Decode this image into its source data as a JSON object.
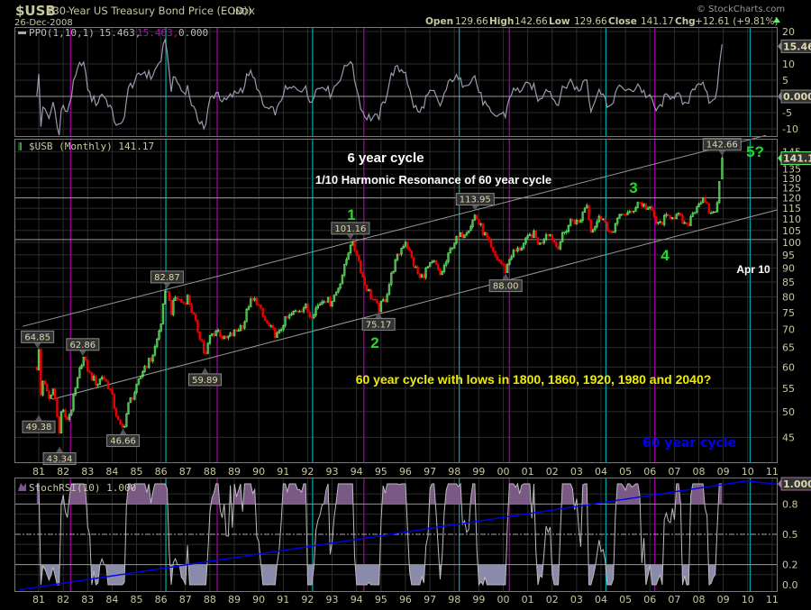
{
  "header": {
    "symbol": "$USB",
    "name": "(30-Year US Treasury Bond Price (EOD))",
    "exchange": "INDX",
    "date": "26-Dec-2008",
    "copyright": "© StockCharts.com",
    "open_label": "Open",
    "open": "129.66",
    "high_label": "High",
    "high": "142.66",
    "low_label": "Low",
    "low": "129.66",
    "close_label": "Close",
    "close": "141.17",
    "chg_label": "Chg",
    "chg": "+12.61 (+9.81%)"
  },
  "colors": {
    "up": "#66ee66",
    "down": "#ee0000",
    "cyan": "#00a0a0",
    "magenta": "#a000a0",
    "axis": "#c8c8a0",
    "blue": "#0000ee",
    "overbought": "#7a5a85",
    "oversold": "#8a8aaa"
  },
  "chart_data": {
    "type": "candlestick",
    "title": "$USB (30-Year US Treasury Bond Price (EOD)) Monthly",
    "x_tick_labels": [
      "81",
      "82",
      "83",
      "84",
      "85",
      "86",
      "87",
      "88",
      "89",
      "90",
      "91",
      "92",
      "93",
      "94",
      "95",
      "96",
      "97",
      "98",
      "99",
      "00",
      "01",
      "02",
      "03",
      "04",
      "05",
      "06",
      "07",
      "08",
      "09",
      "10",
      "11"
    ],
    "x_range_years": [
      1980.0,
      2011.5
    ],
    "price": {
      "legend": "$USB (Monthly) 141.17",
      "scale": "log",
      "ylim": [
        41,
        150
      ],
      "ticks": [
        "45",
        "50",
        "55",
        "60",
        "65",
        "70",
        "75",
        "80",
        "85",
        "90",
        "95",
        "100",
        "105",
        "110",
        "115",
        "120",
        "125",
        "130",
        "135",
        "145"
      ],
      "last_value_label": "141.17",
      "anchors": [
        [
          1980.92,
          60
        ],
        [
          1981.0,
          64.85
        ],
        [
          1981.05,
          52
        ],
        [
          1981.2,
          58
        ],
        [
          1981.4,
          52
        ],
        [
          1981.6,
          55
        ],
        [
          1981.75,
          50
        ],
        [
          1981.85,
          45
        ],
        [
          1981.95,
          52
        ],
        [
          1982.1,
          48
        ],
        [
          1982.3,
          50
        ],
        [
          1982.6,
          57
        ],
        [
          1982.8,
          62.86
        ],
        [
          1983.1,
          58
        ],
        [
          1983.4,
          56
        ],
        [
          1983.6,
          58
        ],
        [
          1983.9,
          55
        ],
        [
          1984.3,
          47
        ],
        [
          1984.45,
          46.66
        ],
        [
          1984.7,
          52
        ],
        [
          1985.0,
          55
        ],
        [
          1985.3,
          60
        ],
        [
          1985.6,
          62
        ],
        [
          1985.8,
          66
        ],
        [
          1986.0,
          72
        ],
        [
          1986.15,
          80
        ],
        [
          1986.25,
          82.87
        ],
        [
          1986.4,
          75
        ],
        [
          1986.6,
          80
        ],
        [
          1986.9,
          78
        ],
        [
          1987.1,
          80
        ],
        [
          1987.4,
          72
        ],
        [
          1987.7,
          66
        ],
        [
          1987.8,
          62
        ],
        [
          1988.0,
          68
        ],
        [
          1988.3,
          70
        ],
        [
          1988.6,
          67
        ],
        [
          1989.0,
          69
        ],
        [
          1989.4,
          72
        ],
        [
          1989.6,
          78
        ],
        [
          1989.9,
          79
        ],
        [
          1990.2,
          73
        ],
        [
          1990.5,
          70
        ],
        [
          1990.8,
          68
        ],
        [
          1991.0,
          72
        ],
        [
          1991.3,
          74
        ],
        [
          1991.6,
          76
        ],
        [
          1991.9,
          77
        ],
        [
          1992.1,
          74
        ],
        [
          1992.4,
          77
        ],
        [
          1992.7,
          80
        ],
        [
          1992.9,
          78
        ],
        [
          1993.2,
          82
        ],
        [
          1993.5,
          90
        ],
        [
          1993.75,
          100
        ],
        [
          1994.0,
          96
        ],
        [
          1994.3,
          85
        ],
        [
          1994.6,
          80
        ],
        [
          1994.9,
          76
        ],
        [
          1995.2,
          80
        ],
        [
          1995.5,
          90
        ],
        [
          1995.8,
          97
        ],
        [
          1996.0,
          101
        ],
        [
          1996.3,
          92
        ],
        [
          1996.6,
          86
        ],
        [
          1996.9,
          90
        ],
        [
          1997.2,
          92
        ],
        [
          1997.4,
          87
        ],
        [
          1997.7,
          93
        ],
        [
          1997.95,
          100
        ],
        [
          1998.3,
          103
        ],
        [
          1998.7,
          108
        ],
        [
          1998.85,
          112
        ],
        [
          1999.0,
          108
        ],
        [
          1999.3,
          102
        ],
        [
          1999.6,
          95
        ],
        [
          1999.9,
          92
        ],
        [
          2000.1,
          89
        ],
        [
          2000.3,
          95
        ],
        [
          2000.6,
          97
        ],
        [
          2000.9,
          100
        ],
        [
          2001.2,
          104
        ],
        [
          2001.5,
          99
        ],
        [
          2001.8,
          105
        ],
        [
          2002.0,
          102
        ],
        [
          2002.2,
          98
        ],
        [
          2002.5,
          104
        ],
        [
          2002.8,
          110
        ],
        [
          2003.1,
          108
        ],
        [
          2003.4,
          118
        ],
        [
          2003.6,
          105
        ],
        [
          2003.9,
          110
        ],
        [
          2004.1,
          112
        ],
        [
          2004.3,
          102
        ],
        [
          2004.6,
          108
        ],
        [
          2004.9,
          113
        ],
        [
          2005.2,
          112
        ],
        [
          2005.5,
          118
        ],
        [
          2005.8,
          116
        ],
        [
          2006.1,
          113
        ],
        [
          2006.3,
          107
        ],
        [
          2006.6,
          110
        ],
        [
          2006.9,
          112
        ],
        [
          2007.2,
          111
        ],
        [
          2007.5,
          106
        ],
        [
          2007.7,
          112
        ],
        [
          2007.9,
          116
        ],
        [
          2008.1,
          119
        ],
        [
          2008.3,
          116
        ],
        [
          2008.5,
          112
        ],
        [
          2008.75,
          116
        ],
        [
          2008.85,
          129.66
        ]
      ],
      "last_bar": {
        "t": 2008.95,
        "open": 129.66,
        "high": 142.66,
        "low": 129.66,
        "close": 141.17
      },
      "point_labels": [
        {
          "text": "64.85",
          "t": 1980.95,
          "p": 64.85,
          "pos": "above"
        },
        {
          "text": "49.38",
          "t": 1981.0,
          "p": 49.38,
          "pos": "below"
        },
        {
          "text": "43.34",
          "t": 1981.85,
          "p": 43.34,
          "pos": "below"
        },
        {
          "text": "62.86",
          "t": 1982.8,
          "p": 62.86,
          "pos": "above"
        },
        {
          "text": "46.66",
          "t": 1984.45,
          "p": 46.66,
          "pos": "below"
        },
        {
          "text": "82.87",
          "t": 1986.25,
          "p": 82.87,
          "pos": "above"
        },
        {
          "text": "59.89",
          "t": 1987.8,
          "p": 59.89,
          "pos": "below"
        },
        {
          "text": "101.16",
          "t": 1993.75,
          "p": 101.16,
          "pos": "above"
        },
        {
          "text": "75.17",
          "t": 1994.9,
          "p": 75.17,
          "pos": "below"
        },
        {
          "text": "113.95",
          "t": 1998.85,
          "p": 113.95,
          "pos": "above"
        },
        {
          "text": "88.00",
          "t": 2000.1,
          "p": 88.0,
          "pos": "below"
        },
        {
          "text": "142.66",
          "t": 2008.95,
          "p": 142.66,
          "pos": "above"
        }
      ],
      "channel_upper": [
        [
          1980.34,
          70.9
        ],
        [
          2010.75,
          155
        ]
      ],
      "channel_lower": [
        [
          1981.55,
          52.6
        ],
        [
          2011.19,
          114.2
        ]
      ],
      "horizontal_levels": [
        120,
        101.16
      ]
    },
    "ppo": {
      "legend_name": "PPO(1,10,1)",
      "legend_v1": "15.463,",
      "legend_v2": "15.463,",
      "legend_v3": "0.000",
      "ticks": [
        "20",
        "10",
        "5",
        "-5",
        "-10"
      ],
      "tick_values": [
        20,
        10,
        5,
        -5,
        -10
      ],
      "value_label": "15.463",
      "zero_label": "0.000",
      "ylim": [
        -12,
        22
      ]
    },
    "stochrsi": {
      "legend": "StochRSI(10) 1.000",
      "ticks": [
        "0.8",
        "0.5",
        "0.2",
        "0.0"
      ],
      "tick_values": [
        0.8,
        0.5,
        0.2,
        0.0
      ],
      "value_label": "1.000",
      "ylim": [
        0,
        1
      ],
      "trendline": [
        [
          1980.2,
          -0.05
        ],
        [
          2010.0,
          1.03
        ],
        [
          2012.6,
          0.955
        ]
      ]
    },
    "cycle_lines": {
      "cyan": [
        1986.2,
        1992.2,
        1998.2,
        2004.2,
        2010.1
      ],
      "magenta": [
        1982.3,
        1988.3,
        1994.3,
        2000.25,
        2006.2
      ]
    },
    "annotations": {
      "six_year": "6 year cycle",
      "harmonic": "1/10 Harmonic Resonance of 60 year cycle",
      "wave1": "1",
      "wave2": "2",
      "wave3": "3",
      "wave4": "4",
      "wave5": "5?",
      "apr10": "Apr 10",
      "sixty_lows": "60 year cycle with lows in 1800, 1860, 1920, 1980 and 2040?",
      "sixty_cycle": "60 year cycle"
    }
  }
}
